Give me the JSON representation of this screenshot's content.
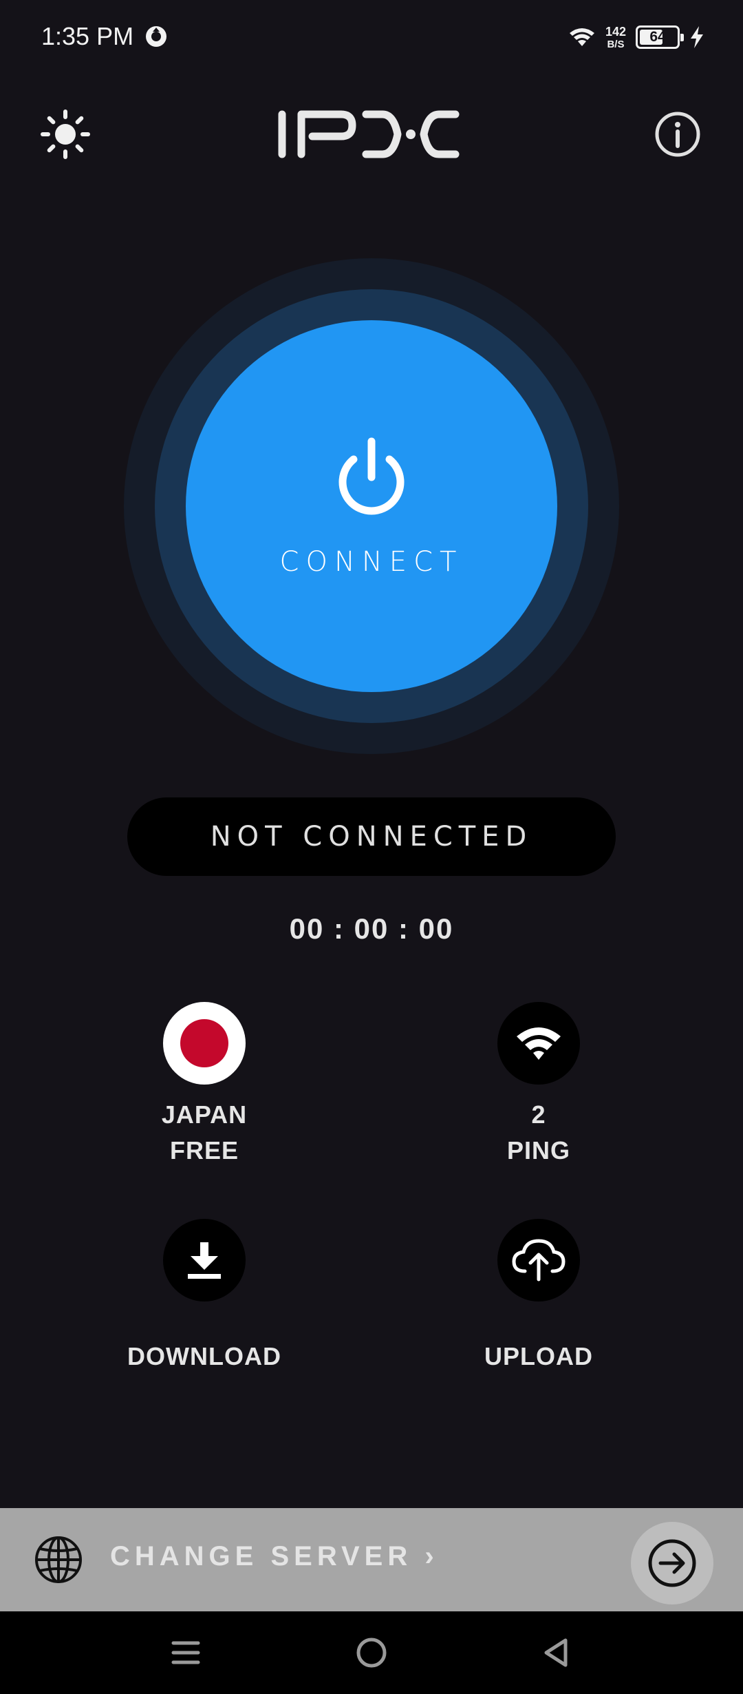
{
  "status_bar": {
    "time": "1:35 PM",
    "net_speed_value": "142",
    "net_speed_unit": "B/S",
    "battery_level": "64",
    "battery_percent": 64,
    "charging": true
  },
  "header": {
    "logo_text": "IPXC"
  },
  "connect": {
    "label": "CONNECT",
    "status": "NOT CONNECTED",
    "timer": "00 : 00 : 00",
    "accent_color": "#2196f3"
  },
  "stats": {
    "country": "JAPAN",
    "tier": "FREE",
    "ping_value": "2",
    "ping_label": "PING",
    "download_label": "DOWNLOAD",
    "upload_label": "UPLOAD"
  },
  "server_bar": {
    "label": "CHANGE SERVER ›"
  },
  "icons": [
    "brightness-icon",
    "logo",
    "info-icon",
    "power-icon",
    "japan-flag-icon",
    "wifi-icon",
    "download-icon",
    "cloud-upload-icon",
    "globe-icon",
    "arrow-right-icon",
    "menu-icon",
    "home-icon",
    "back-icon"
  ]
}
